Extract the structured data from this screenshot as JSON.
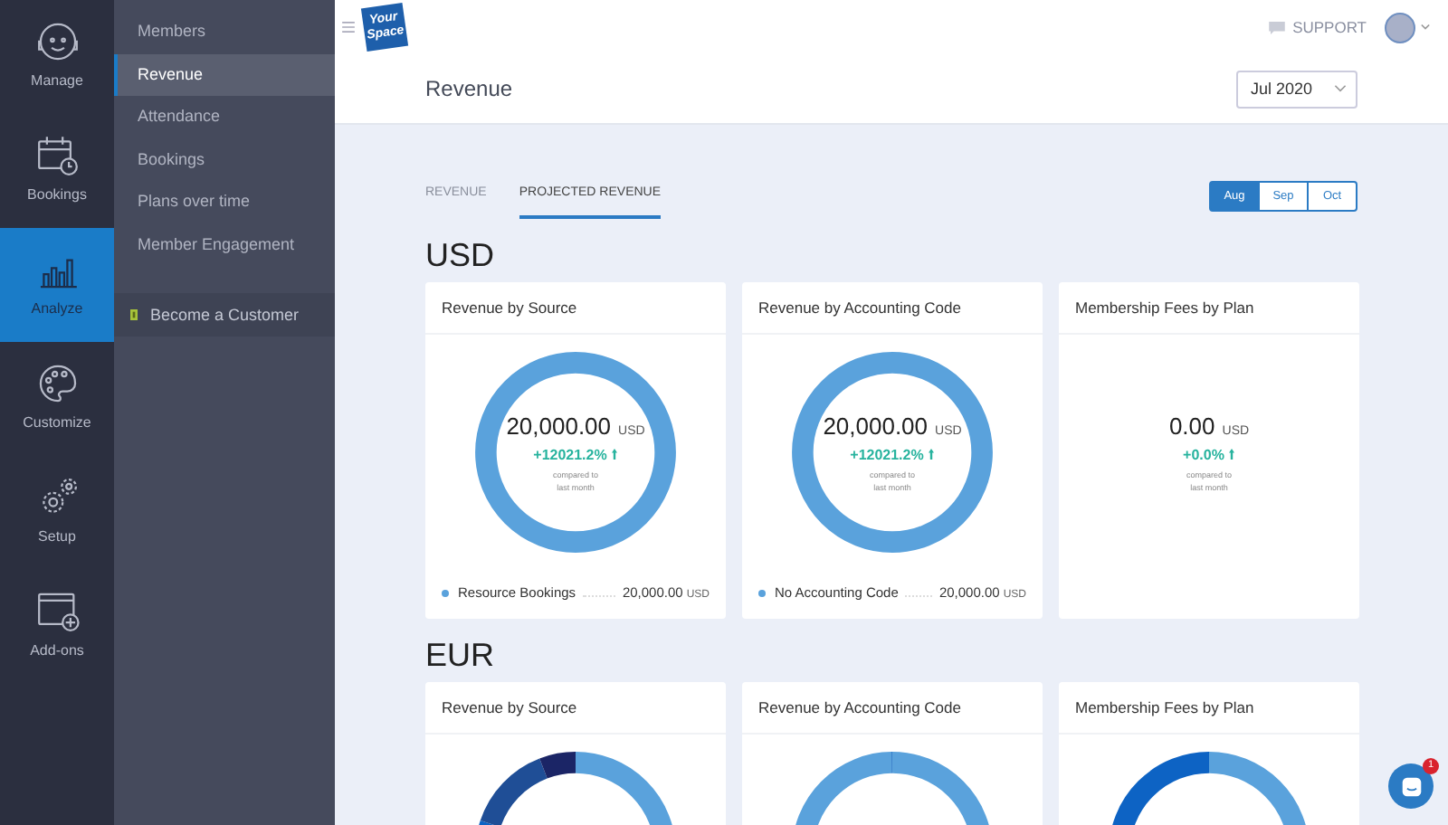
{
  "rail": [
    {
      "label": "Manage",
      "selected": false
    },
    {
      "label": "Bookings",
      "selected": false
    },
    {
      "label": "Analyze",
      "selected": true
    },
    {
      "label": "Customize",
      "selected": false
    },
    {
      "label": "Setup",
      "selected": false
    },
    {
      "label": "Add-ons",
      "selected": false
    }
  ],
  "submenu": {
    "items": [
      {
        "label": "Members",
        "selected": false
      },
      {
        "label": "Revenue",
        "selected": true
      },
      {
        "label": "Attendance",
        "selected": false
      },
      {
        "label": "Bookings",
        "selected": false
      },
      {
        "label": "Plans over time",
        "selected": false
      },
      {
        "label": "Member Engagement",
        "selected": false
      }
    ],
    "cta": "Become a Customer"
  },
  "topbar": {
    "logo_top": "Your",
    "logo_bottom": "Space",
    "support": "SUPPORT"
  },
  "header": {
    "title": "Revenue",
    "month": "Jul 2020"
  },
  "tabs": [
    {
      "label": "REVENUE",
      "selected": false
    },
    {
      "label": "PROJECTED REVENUE",
      "selected": true
    }
  ],
  "months": [
    {
      "label": "Aug",
      "selected": true
    },
    {
      "label": "Sep",
      "selected": false
    },
    {
      "label": "Oct",
      "selected": false
    }
  ],
  "sections": [
    {
      "currency": "USD",
      "cards": [
        {
          "title": "Revenue by Source",
          "total": "20,000.00",
          "unit": "USD",
          "change": "+12021.2%",
          "compared": "compared to last month",
          "legend": [
            {
              "label": "Resource Bookings",
              "value": "20,000.00",
              "unit": "USD",
              "color": "#5aa2dc"
            }
          ]
        },
        {
          "title": "Revenue by Accounting Code",
          "total": "20,000.00",
          "unit": "USD",
          "change": "+12021.2%",
          "compared": "compared to last month",
          "legend": [
            {
              "label": "No Accounting Code",
              "value": "20,000.00",
              "unit": "USD",
              "color": "#5aa2dc"
            }
          ]
        },
        {
          "title": "Membership Fees by Plan",
          "total": "0.00",
          "unit": "USD",
          "change": "+0.0%",
          "compared": "compared to last month"
        }
      ]
    },
    {
      "currency": "EUR",
      "cards": [
        {
          "title": "Revenue by Source"
        },
        {
          "title": "Revenue by Accounting Code"
        },
        {
          "title": "Membership Fees by Plan"
        }
      ]
    }
  ],
  "chat": {
    "badge": "1"
  }
}
